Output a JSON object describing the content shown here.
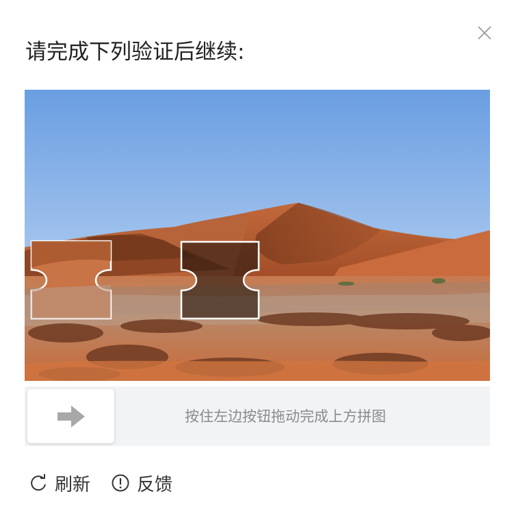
{
  "dialog": {
    "title": "请完成下列验证后继续:",
    "close_icon": "close-icon"
  },
  "captcha": {
    "image_description_icon": "desert-dunes-image",
    "slider_hint": "按住左边按钮拖动完成上方拼图",
    "handle_icon": "arrow-right-icon",
    "handle_icon_color": "#999999"
  },
  "footer": {
    "refresh_label": "刷新",
    "refresh_icon": "refresh-icon",
    "feedback_label": "反馈",
    "feedback_icon": "alert-circle-icon"
  },
  "colors": {
    "title": "#222222",
    "hint": "#8a8a8a",
    "track": "#f2f3f5",
    "sky_top": "#6b9fe0",
    "sand": "#c9683a"
  }
}
